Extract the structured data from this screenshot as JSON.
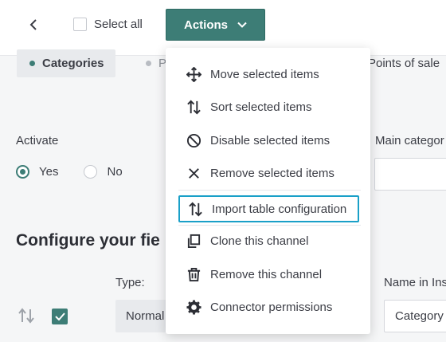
{
  "toolbar": {
    "back_icon": "chevron-left-icon",
    "select_all_label": "Select all",
    "actions_label": "Actions"
  },
  "tabs": [
    {
      "label": "Categories",
      "active": true
    },
    {
      "label": "P",
      "active": false
    },
    {
      "label": "Points of sale",
      "active": false
    }
  ],
  "form": {
    "activate_label": "Activate",
    "yes_label": "Yes",
    "no_label": "No",
    "activate_value": "Yes",
    "main_category_label": "Main categor",
    "section_title": "Configure your fie",
    "type_label": "Type:",
    "name_label": "Name in Ins",
    "type_value": "Normal",
    "name_value": "Category l"
  },
  "menu": {
    "items": [
      {
        "label": "Move selected items",
        "icon": "move-icon"
      },
      {
        "label": "Sort selected items",
        "icon": "sort-icon"
      },
      {
        "label": "Disable selected items",
        "icon": "disable-icon"
      },
      {
        "label": "Remove selected items",
        "icon": "close-icon"
      },
      {
        "label": "Import table configuration",
        "icon": "sort-icon"
      },
      {
        "label": "Clone this channel",
        "icon": "clone-icon"
      },
      {
        "label": "Remove this channel",
        "icon": "trash-icon"
      },
      {
        "label": "Connector permissions",
        "icon": "gear-icon"
      }
    ]
  },
  "colors": {
    "accent": "#3d7d76",
    "focus_ring": "#1aa0c8"
  }
}
